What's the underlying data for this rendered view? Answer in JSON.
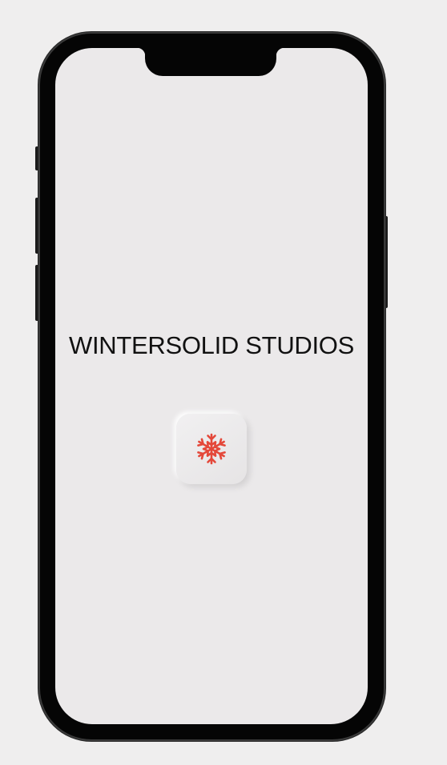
{
  "app": {
    "studio_name": "WINTERSOLID STUDIOS"
  },
  "logo": {
    "icon": "snowflake-icon",
    "icon_color": "#e4483a"
  },
  "colors": {
    "screen_background": "#ebe9ea",
    "device_frame": "#050505",
    "page_background": "#efeeee",
    "title_text": "#111111"
  }
}
